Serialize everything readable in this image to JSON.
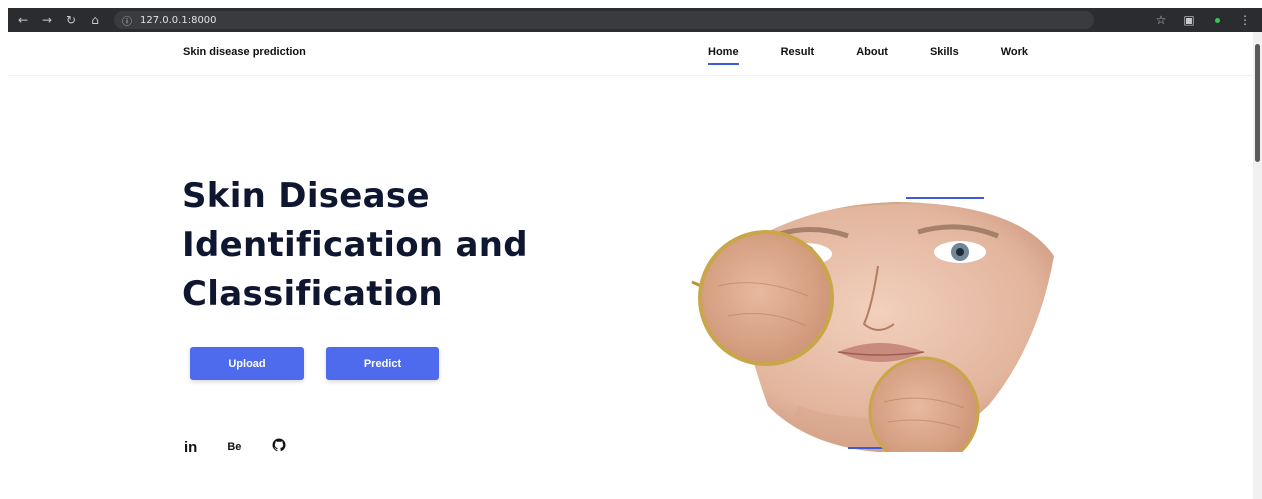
{
  "browser": {
    "url": "127.0.0.1:8000",
    "icons": [
      "back-icon",
      "forward-icon",
      "reload-icon",
      "home-icon",
      "site-info-icon",
      "bookmark-star-icon",
      "extensions-icon",
      "menu-dots-icon"
    ]
  },
  "header": {
    "brand": "Skin disease prediction",
    "menu": [
      {
        "label": "Home",
        "active": true
      },
      {
        "label": "Result",
        "active": false
      },
      {
        "label": "About",
        "active": false
      },
      {
        "label": "Skills",
        "active": false
      },
      {
        "label": "Work",
        "active": false
      }
    ],
    "accent_color": "#3b5bdb"
  },
  "hero": {
    "title_lines": [
      "Skin Disease",
      "Identification and",
      "Classification"
    ],
    "buttons": {
      "upload_label": "Upload",
      "predict_label": "Predict",
      "color": "#4f6bed"
    },
    "socials": {
      "linkedin": "in",
      "behance": "Be",
      "github_icon": "github-icon"
    },
    "image": {
      "subject": "face-with-magnifying-lenses"
    }
  }
}
